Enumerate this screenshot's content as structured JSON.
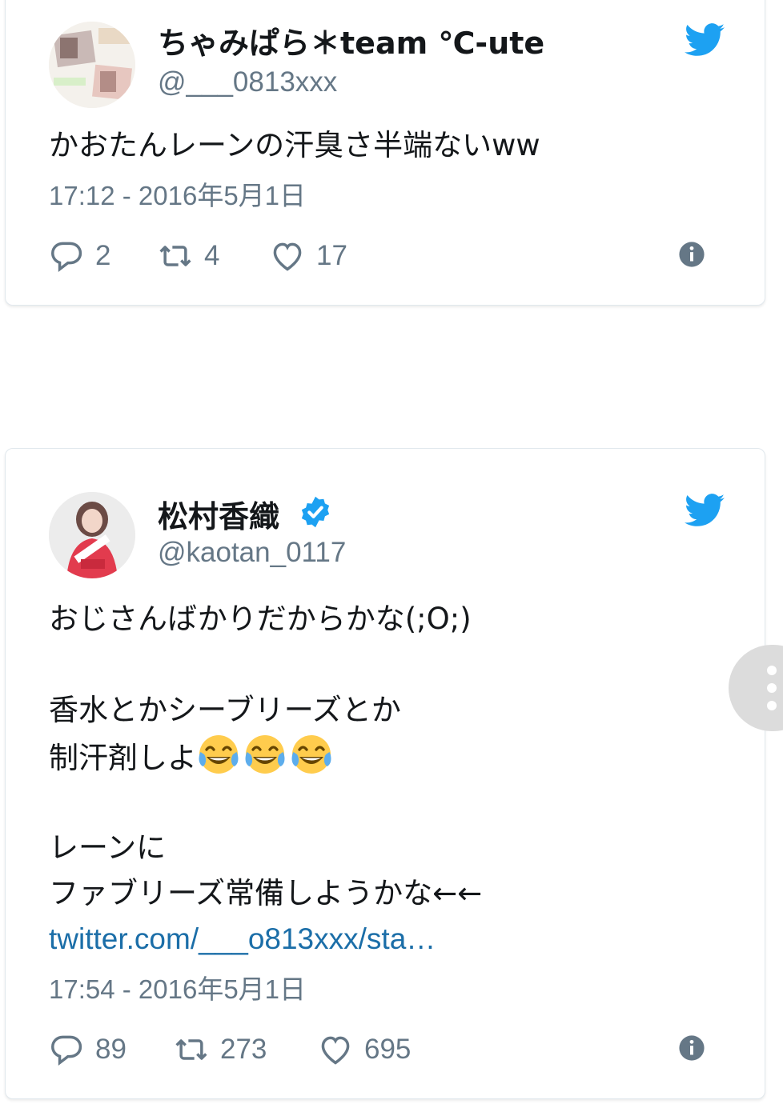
{
  "tweets": [
    {
      "display_name": "ちゃみぱら＊team ℃-ute",
      "handle": "@___0813xxx",
      "verified": false,
      "lines": [
        "かおたんレーンの汗臭さ半端ないww"
      ],
      "timestamp": "17:12 - 2016年5月1日",
      "replies": "2",
      "retweets": "4",
      "likes": "17"
    },
    {
      "display_name": "松村香織",
      "handle": "@kaotan_0117",
      "verified": true,
      "lines": [
        "おじさんばかりだからかな(;O;)",
        "",
        "香水とかシーブリーズとか",
        "制汗剤しよ",
        "",
        "レーンに",
        "ファブリーズ常備しようかな←←"
      ],
      "emoji_after_line_4": [
        "face-with-tears-of-joy",
        "face-with-tears-of-joy",
        "face-with-tears-of-joy"
      ],
      "link": "twitter.com/___o813xxx/sta…",
      "timestamp": "17:54 - 2016年5月1日",
      "replies": "89",
      "retweets": "273",
      "likes": "695"
    }
  ],
  "colors": {
    "twitter_blue": "#1da1f2",
    "link": "#1b6ea8",
    "secondary_text": "#657786",
    "border": "#e1e8ed"
  },
  "icons": [
    "twitter-bird-icon",
    "reply-icon",
    "retweet-icon",
    "like-icon",
    "info-icon",
    "verified-badge-icon",
    "more-vertical-icon"
  ]
}
